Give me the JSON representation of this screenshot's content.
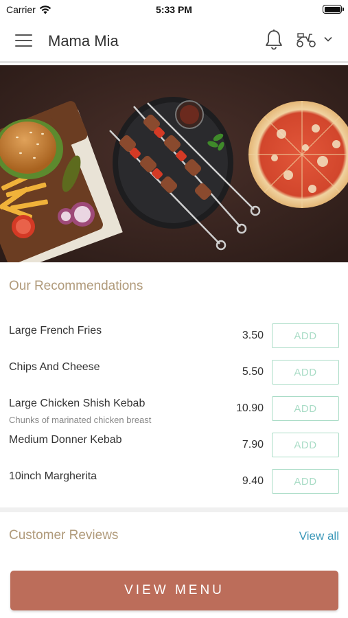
{
  "status_bar": {
    "carrier": "Carrier",
    "time": "5:33 PM"
  },
  "header": {
    "title": "Mama Mia",
    "icons": [
      "menu-icon",
      "bell-icon",
      "delivery-scooter-icon",
      "chevron-down-icon"
    ]
  },
  "hero": {
    "image": "food-banner-burger-kebab-pizza"
  },
  "recommendations": {
    "title": "Our Recommendations",
    "items": [
      {
        "name": "Large French Fries",
        "description": "",
        "price": "3.50",
        "add_label": "ADD"
      },
      {
        "name": "Chips And Cheese",
        "description": "",
        "price": "5.50",
        "add_label": "ADD"
      },
      {
        "name": "Large Chicken Shish Kebab",
        "description": "Chunks of marinated chicken breast",
        "price": "10.90",
        "add_label": "ADD"
      },
      {
        "name": "Medium Donner Kebab",
        "description": "",
        "price": "7.90",
        "add_label": "ADD"
      },
      {
        "name": "10inch Margherita",
        "description": "",
        "price": "9.40",
        "add_label": "ADD"
      }
    ]
  },
  "reviews": {
    "title": "Customer Reviews",
    "view_all_label": "View all"
  },
  "footer": {
    "view_menu_label": "VIEW MENU"
  },
  "colors": {
    "accent_title": "#b09a7a",
    "add_button": "#a9dcc6",
    "link": "#3a97b8",
    "primary_button": "#bc6d5a"
  }
}
